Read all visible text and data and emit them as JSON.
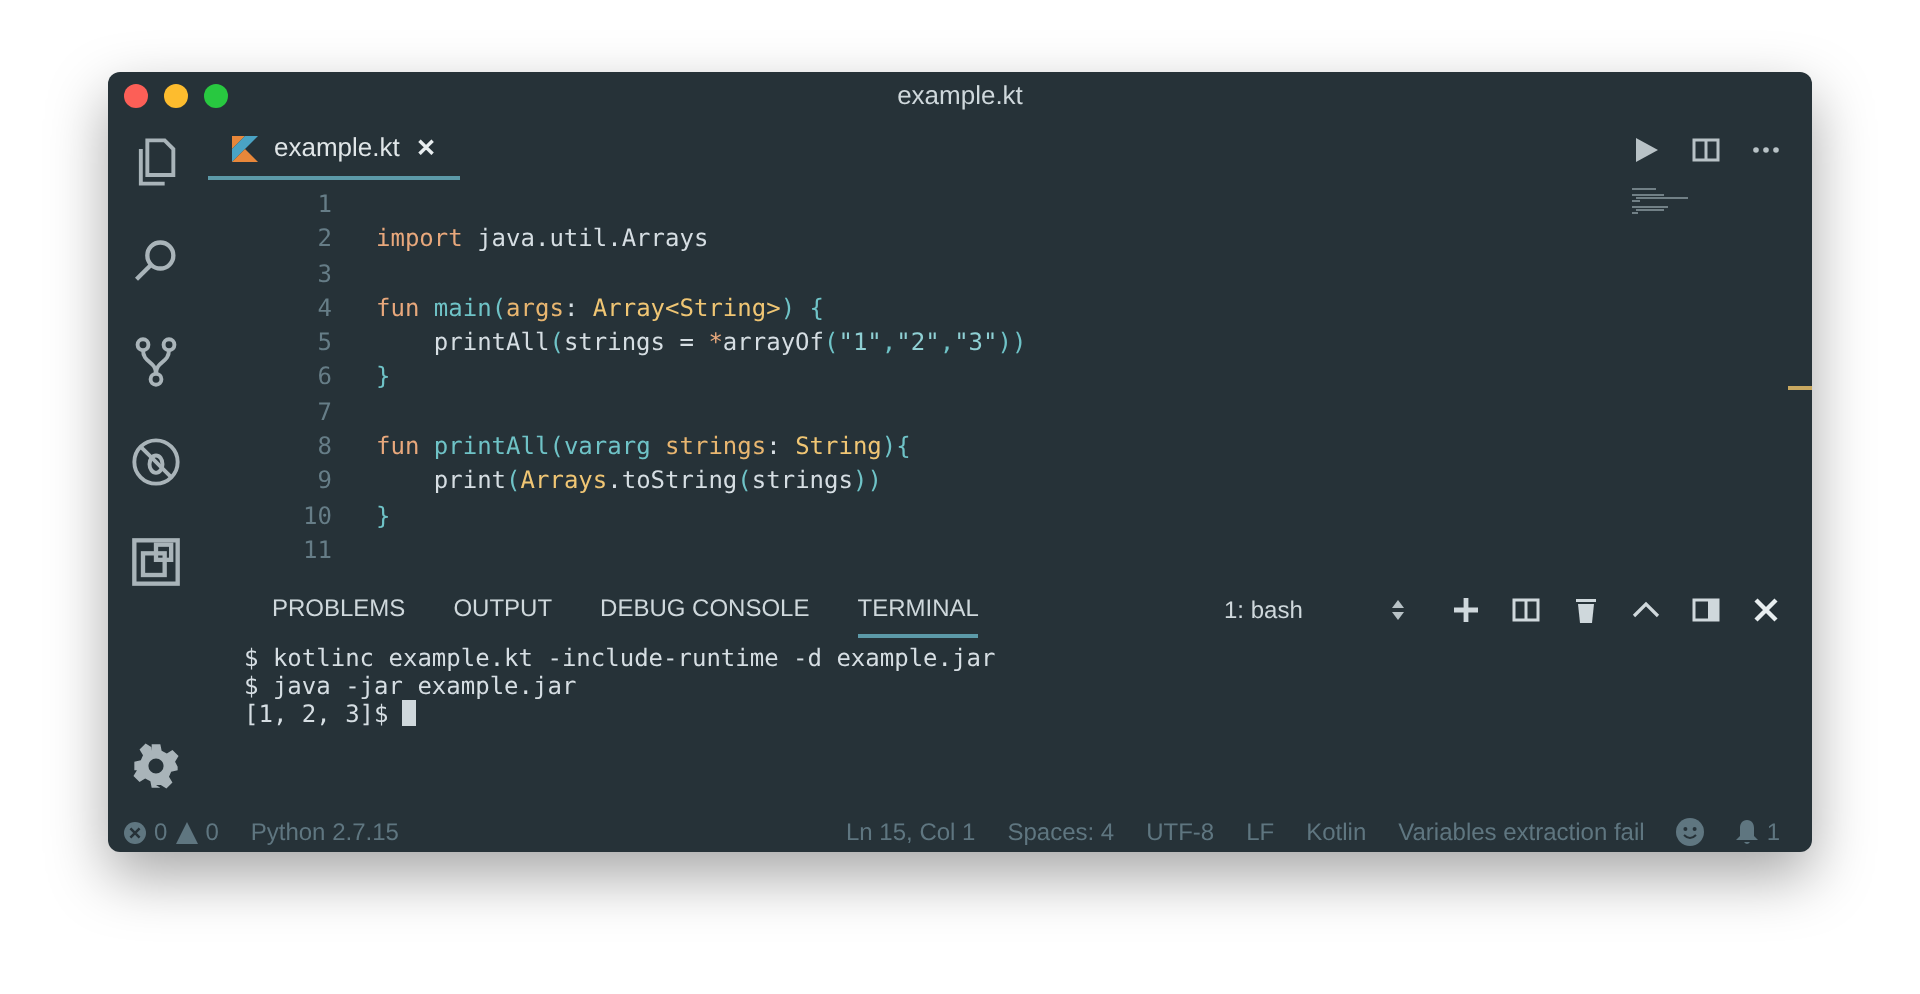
{
  "window": {
    "title": "example.kt"
  },
  "editor_tabs": [
    {
      "label": "example.kt",
      "close": "✕",
      "selected": true
    }
  ],
  "code": {
    "lines": [
      {
        "number": "1"
      },
      {
        "number": "2",
        "tokens": [
          {
            "text": "import",
            "kind": "keyword"
          },
          {
            "text": " java.util.Arrays",
            "kind": "plain"
          }
        ]
      },
      {
        "number": "3"
      },
      {
        "number": "4",
        "tokens": [
          {
            "text": "fun",
            "kind": "keyword"
          },
          {
            "text": " main",
            "kind": "function"
          },
          {
            "text": "(",
            "kind": "punct"
          },
          {
            "text": "args",
            "kind": "param"
          },
          {
            "text": ": ",
            "kind": "plain"
          },
          {
            "text": "Array<String>",
            "kind": "type"
          },
          {
            "text": ") {",
            "kind": "punct"
          }
        ]
      },
      {
        "number": "5",
        "tokens": [
          {
            "text": "    printAll",
            "kind": "plain"
          },
          {
            "text": "(",
            "kind": "punct"
          },
          {
            "text": "strings = ",
            "kind": "plain"
          },
          {
            "text": "*",
            "kind": "operator"
          },
          {
            "text": "arrayOf",
            "kind": "plain"
          },
          {
            "text": "(",
            "kind": "punct"
          },
          {
            "text": "\"1\"",
            "kind": "string"
          },
          {
            "text": ",",
            "kind": "punct"
          },
          {
            "text": "\"2\"",
            "kind": "string"
          },
          {
            "text": ",",
            "kind": "punct"
          },
          {
            "text": "\"3\"",
            "kind": "string"
          },
          {
            "text": "))",
            "kind": "punct"
          }
        ]
      },
      {
        "number": "6",
        "tokens": [
          {
            "text": "}",
            "kind": "punct"
          }
        ]
      },
      {
        "number": "7"
      },
      {
        "number": "8",
        "tokens": [
          {
            "text": "fun",
            "kind": "keyword"
          },
          {
            "text": " printAll",
            "kind": "function"
          },
          {
            "text": "(",
            "kind": "punct"
          },
          {
            "text": "vararg",
            "kind": "function"
          },
          {
            "text": " strings",
            "kind": "param"
          },
          {
            "text": ": ",
            "kind": "plain"
          },
          {
            "text": "String",
            "kind": "type"
          },
          {
            "text": "){",
            "kind": "punct"
          }
        ]
      },
      {
        "number": "9",
        "tokens": [
          {
            "text": "    print",
            "kind": "plain"
          },
          {
            "text": "(",
            "kind": "punct"
          },
          {
            "text": "Arrays",
            "kind": "type"
          },
          {
            "text": ".toString",
            "kind": "plain"
          },
          {
            "text": "(",
            "kind": "punct"
          },
          {
            "text": "strings",
            "kind": "plain"
          },
          {
            "text": "))",
            "kind": "punct"
          }
        ]
      },
      {
        "number": "10",
        "tokens": [
          {
            "text": "}",
            "kind": "punct"
          }
        ]
      },
      {
        "number": "11"
      }
    ]
  },
  "panel": {
    "tabs": [
      {
        "label": "PROBLEMS",
        "selected": false
      },
      {
        "label": "OUTPUT",
        "selected": false
      },
      {
        "label": "DEBUG CONSOLE",
        "selected": false
      },
      {
        "label": "TERMINAL",
        "selected": true
      }
    ],
    "terminal_select": "1: bash",
    "terminal_lines": [
      "$ kotlinc example.kt -include-runtime -d example.jar",
      "$ java -jar example.jar",
      "[1, 2, 3]$ "
    ]
  },
  "status_bar": {
    "errors": "0",
    "warnings": "0",
    "interpreter": "Python 2.7.15",
    "items": [
      "Ln 15, Col 1",
      "Spaces: 4",
      "UTF-8",
      "LF",
      "Kotlin",
      "Variables extraction fail"
    ],
    "notifications": "1"
  }
}
